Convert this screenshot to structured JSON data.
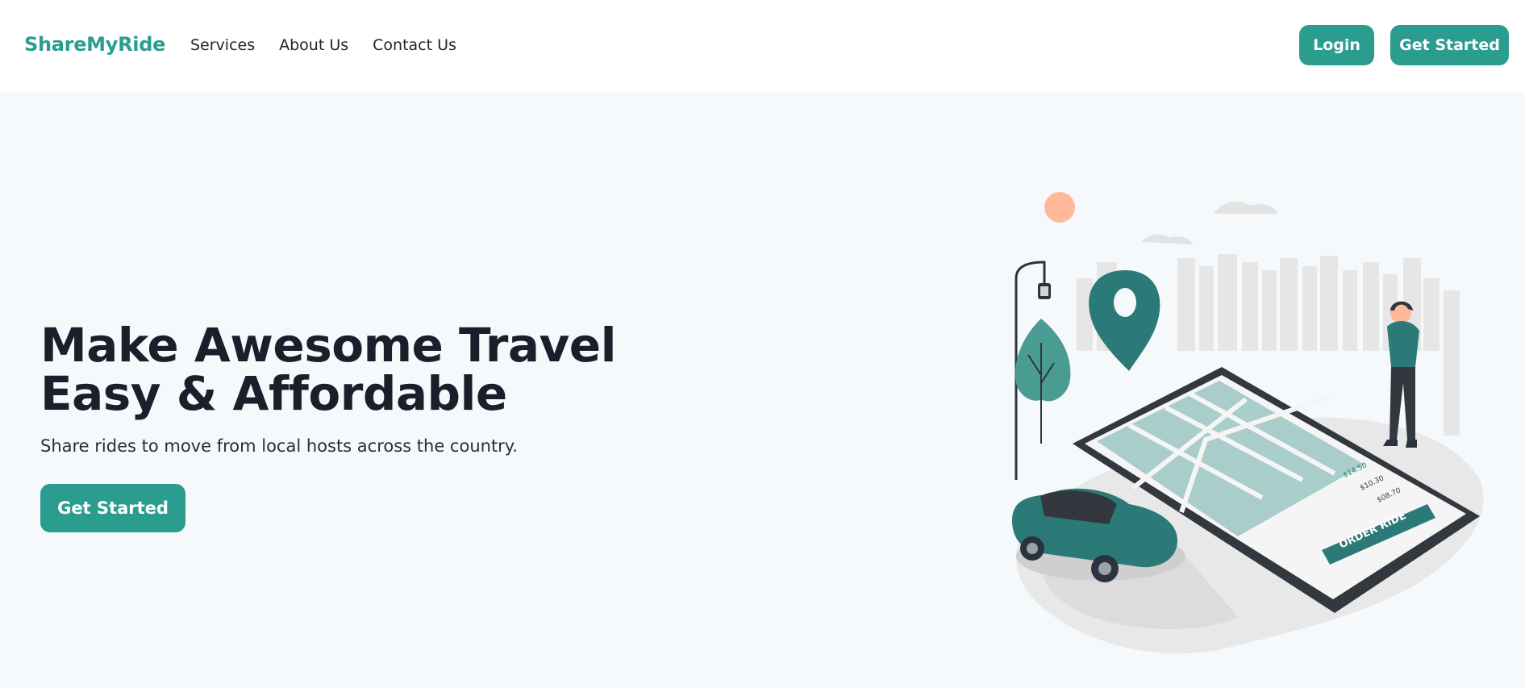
{
  "header": {
    "brand": "ShareMyRide",
    "nav": [
      {
        "label": "Services"
      },
      {
        "label": "About Us"
      },
      {
        "label": "Contact Us"
      }
    ],
    "login_label": "Login",
    "get_started_label": "Get Started"
  },
  "hero": {
    "title_line1": "Make Awesome Travel",
    "title_line2": "Easy & Affordable",
    "subtitle": "Share rides to move from local hosts across the country.",
    "cta_label": "Get Started"
  },
  "illustration": {
    "prices": [
      "$14.50",
      "$10.30",
      "$08.70"
    ],
    "order_label": "ORDER RIDE"
  },
  "colors": {
    "accent": "#2a9d8f",
    "background": "#f6f9fb",
    "header_bg": "#ffffff",
    "text_dark": "#1c1f2b"
  }
}
